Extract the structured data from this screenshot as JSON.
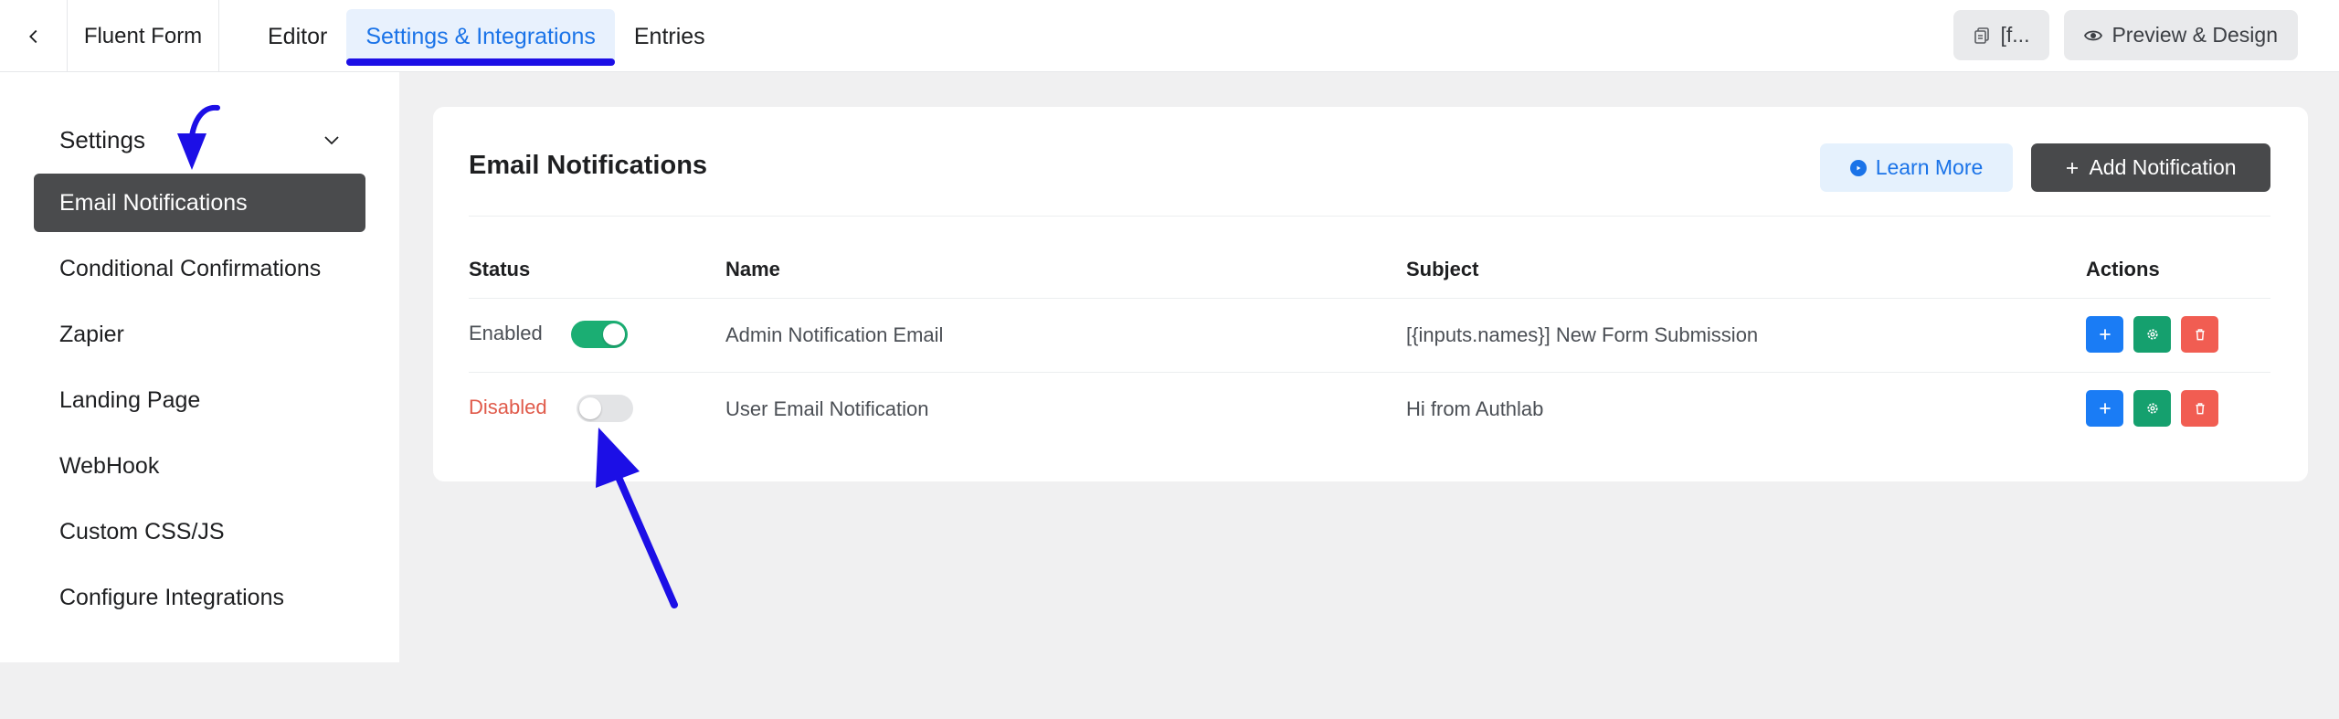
{
  "topbar": {
    "back_icon": "chevron-left-icon",
    "form_name": "Fluent Form",
    "tabs": [
      {
        "label": "Editor",
        "active": false
      },
      {
        "label": "Settings & Integrations",
        "active": true
      },
      {
        "label": "Entries",
        "active": false
      }
    ],
    "shortcode_button": "[f...",
    "preview_button": "Preview & Design"
  },
  "sidebar": {
    "section_title": "Settings",
    "items": [
      {
        "label": "Email Notifications",
        "active": true
      },
      {
        "label": "Conditional Confirmations",
        "active": false
      },
      {
        "label": "Zapier",
        "active": false
      },
      {
        "label": "Landing Page",
        "active": false
      },
      {
        "label": "WebHook",
        "active": false
      },
      {
        "label": "Custom CSS/JS",
        "active": false
      },
      {
        "label": "Configure Integrations",
        "active": false
      }
    ]
  },
  "main": {
    "title": "Email Notifications",
    "learn_more": "Learn More",
    "add_notification": "Add Notification",
    "columns": {
      "status": "Status",
      "name": "Name",
      "subject": "Subject",
      "actions": "Actions"
    },
    "rows": [
      {
        "status": "Enabled",
        "enabled": true,
        "name": "Admin Notification Email",
        "subject": "[{inputs.names}] New Form Submission"
      },
      {
        "status": "Disabled",
        "enabled": false,
        "name": "User Email Notification",
        "subject": "Hi from Authlab"
      }
    ]
  },
  "colors": {
    "accent": "#1a73e8",
    "active_tab_underline": "#1c0fe6",
    "toggle_on": "#1bae73",
    "disabled_text": "#e05a4a",
    "annotation_arrow": "#1c0fe6"
  }
}
